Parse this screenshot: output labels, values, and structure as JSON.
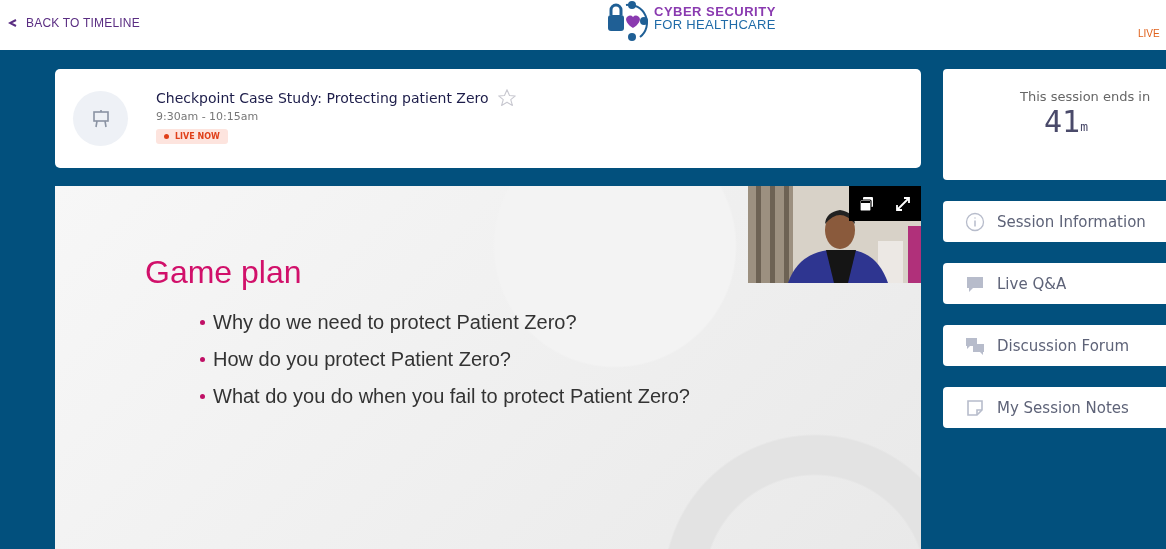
{
  "header": {
    "back_link": "BACK TO TIMELINE",
    "logo": {
      "line_1": "CYBER SECURITY",
      "line_2": "FOR HEALTHCARE"
    },
    "live_tab": "LIVE"
  },
  "session": {
    "title": "Checkpoint Case Study: Protecting patient Zero",
    "starred": false,
    "time": "9:30am - 10:15am",
    "badge": "LIVE NOW"
  },
  "slide": {
    "heading": "Game plan",
    "bullets": [
      "Why do we need to protect Patient Zero?",
      "How do you protect Patient Zero?",
      "What do you do when you fail to protect Patient Zero?"
    ],
    "camera": {
      "kind": "picture"
    }
  },
  "timer": {
    "label": "This session ends in",
    "value": "41",
    "unit": "m"
  },
  "actions": [
    {
      "kind": "info",
      "label": "Session Information"
    },
    {
      "kind": "chat",
      "label": "Live Q&A"
    },
    {
      "kind": "forum",
      "label": "Discussion Forum"
    },
    {
      "kind": "notes",
      "label": "My Session Notes"
    }
  ]
}
